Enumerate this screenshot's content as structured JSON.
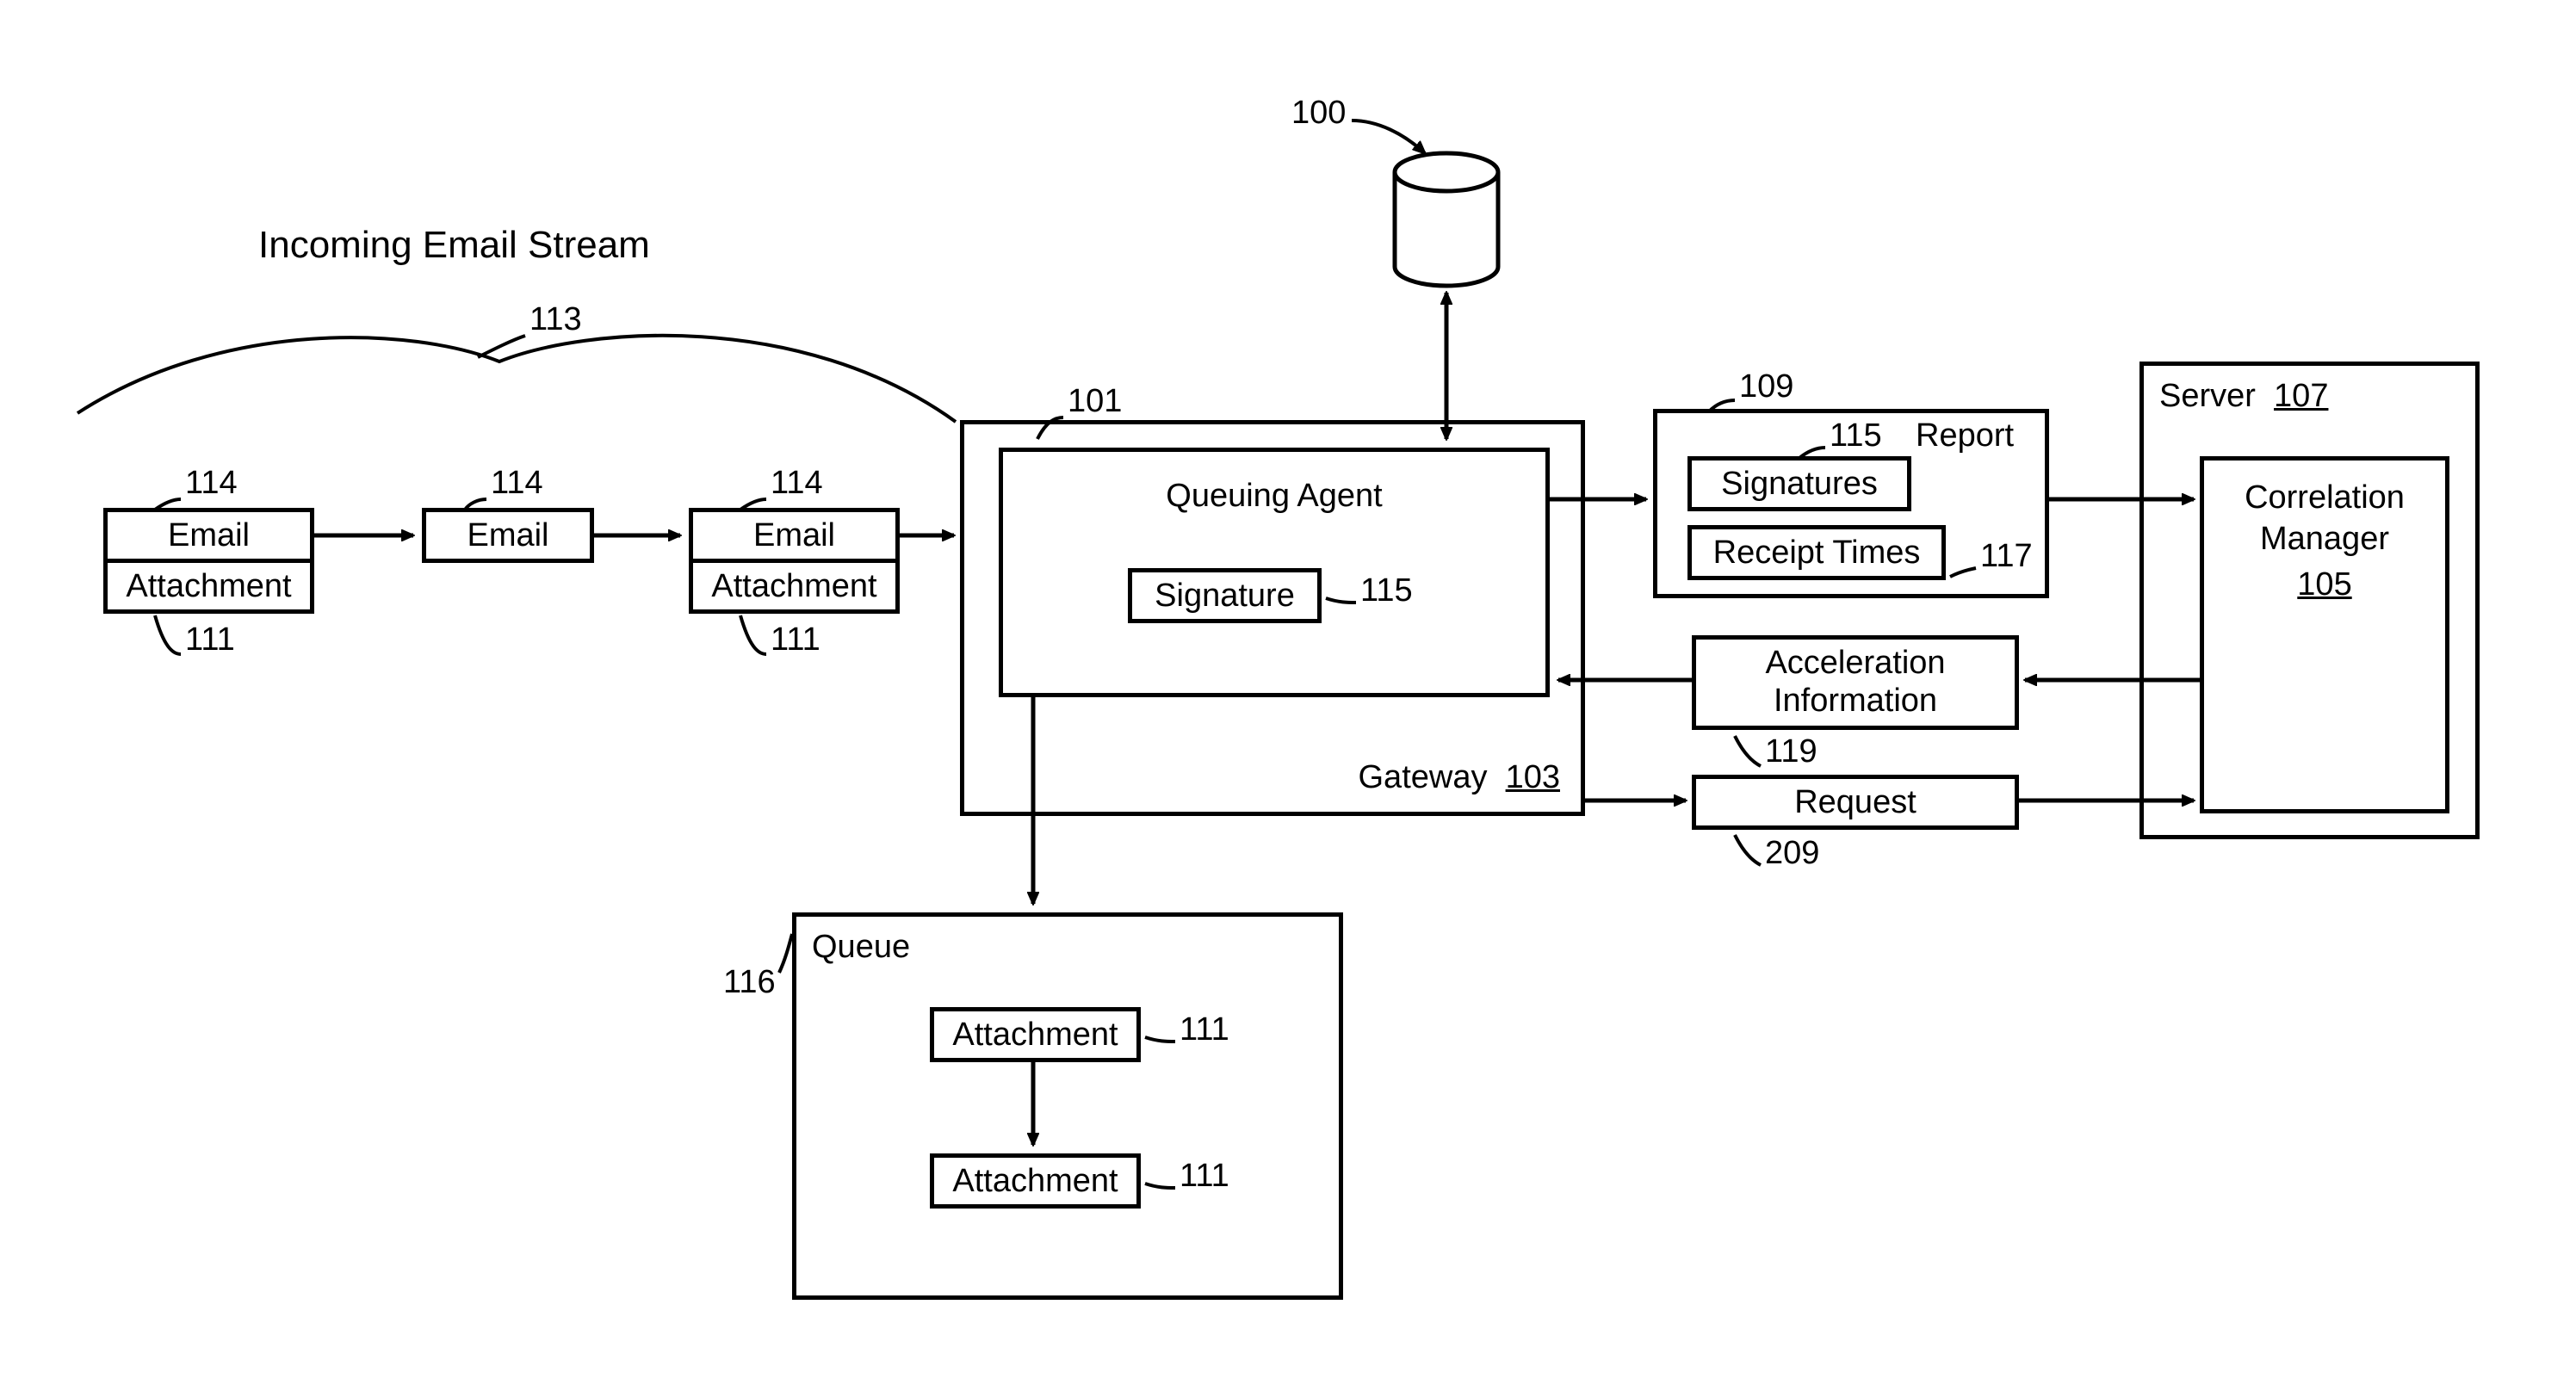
{
  "title": "Incoming Email Stream",
  "refs": {
    "db": "100",
    "agent": "101",
    "gateway": "103",
    "corrmgr": "105",
    "server": "107",
    "report": "109",
    "attachment": "111",
    "stream": "113",
    "email": "114",
    "signature": "115",
    "queue": "116",
    "receipt": "117",
    "accel": "119",
    "request": "209"
  },
  "labels": {
    "email": "Email",
    "attachment": "Attachment",
    "queuing_agent": "Queuing Agent",
    "signature": "Signature",
    "gateway": "Gateway",
    "queue": "Queue",
    "signatures": "Signatures",
    "receipt_times": "Receipt Times",
    "report": "Report",
    "acceleration_information": "Acceleration\nInformation",
    "request": "Request",
    "server": "Server",
    "correlation_manager": "Correlation\nManager"
  }
}
